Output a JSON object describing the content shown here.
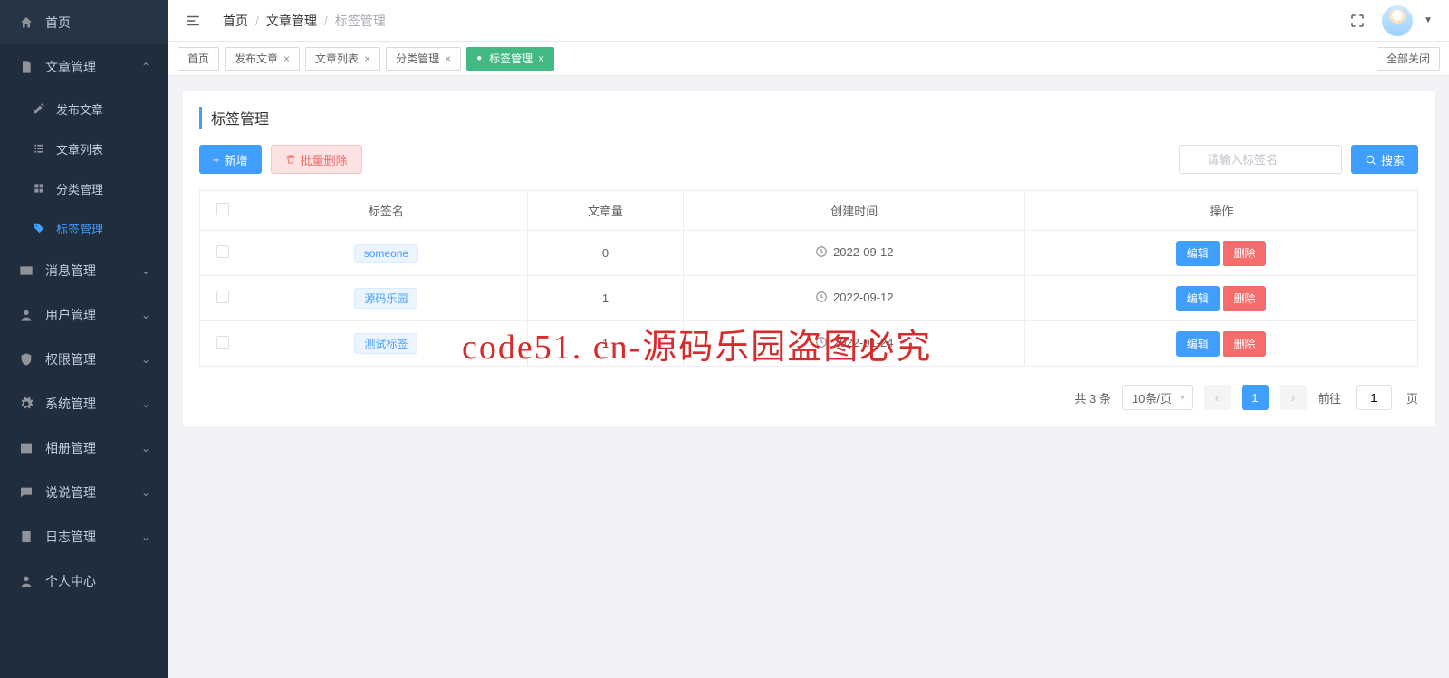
{
  "sidebar": {
    "items": [
      {
        "key": "home",
        "icon": "home",
        "label": "首页"
      },
      {
        "key": "article",
        "icon": "doc",
        "label": "文章管理",
        "expanded": true,
        "children": [
          {
            "key": "publish",
            "icon": "pencil",
            "label": "发布文章"
          },
          {
            "key": "list",
            "icon": "list",
            "label": "文章列表"
          },
          {
            "key": "category",
            "icon": "grid",
            "label": "分类管理"
          },
          {
            "key": "tag",
            "icon": "tag",
            "label": "标签管理",
            "active": true
          }
        ]
      },
      {
        "key": "message",
        "icon": "mail",
        "label": "消息管理",
        "collapsible": true
      },
      {
        "key": "user",
        "icon": "user",
        "label": "用户管理",
        "collapsible": true
      },
      {
        "key": "perm",
        "icon": "shield",
        "label": "权限管理",
        "collapsible": true
      },
      {
        "key": "system",
        "icon": "gear",
        "label": "系统管理",
        "collapsible": true
      },
      {
        "key": "album",
        "icon": "image",
        "label": "相册管理",
        "collapsible": true
      },
      {
        "key": "talk",
        "icon": "chat",
        "label": "说说管理",
        "collapsible": true
      },
      {
        "key": "log",
        "icon": "log",
        "label": "日志管理",
        "collapsible": true
      },
      {
        "key": "profile",
        "icon": "person",
        "label": "个人中心"
      }
    ]
  },
  "breadcrumb": [
    "首页",
    "文章管理",
    "标签管理"
  ],
  "tabs": {
    "items": [
      {
        "label": "首页",
        "closable": false
      },
      {
        "label": "发布文章",
        "closable": true
      },
      {
        "label": "文章列表",
        "closable": true
      },
      {
        "label": "分类管理",
        "closable": true
      },
      {
        "label": "标签管理",
        "closable": true,
        "active": true
      }
    ],
    "close_all_label": "全部关闭"
  },
  "page": {
    "title": "标签管理",
    "add_label": "新增",
    "batch_delete_label": "批量删除",
    "search_placeholder": "请输入标签名",
    "search_btn": "搜索",
    "columns": [
      "标签名",
      "文章量",
      "创建时间",
      "操作"
    ],
    "edit_label": "编辑",
    "delete_label": "删除",
    "rows": [
      {
        "name": "someone",
        "count": "0",
        "date": "2022-09-12"
      },
      {
        "name": "源码乐园",
        "count": "1",
        "date": "2022-09-12"
      },
      {
        "name": "测试标签",
        "count": "1",
        "date": "2022-01-24"
      }
    ]
  },
  "pagination": {
    "total_text": "共 3 条",
    "page_size_label": "10条/页",
    "current": "1",
    "goto_prefix": "前往",
    "goto_suffix": "页",
    "goto_value": "1"
  },
  "watermark": "code51. cn-源码乐园盗图必究"
}
